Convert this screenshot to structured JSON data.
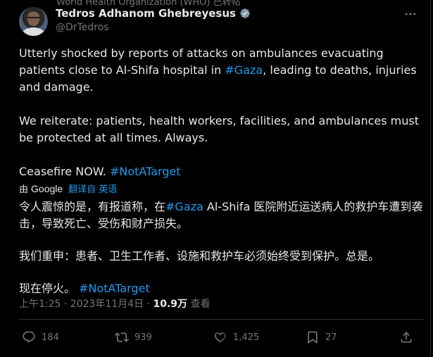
{
  "context": {
    "text": "World Health Organization (WHO) 已转帖"
  },
  "author": {
    "display_name": "Tedros Adhanom Ghebreyesus",
    "handle": "@DrTedros"
  },
  "tweet": {
    "para1": {
      "before": "Utterly shocked by reports of attacks on ambulances evacuating patients close to Al-Shifa hospital in ",
      "hashtag": "#Gaza",
      "after": ", leading to deaths, injuries and damage."
    },
    "para2": "We reiterate: patients, health workers, facilities, and ambulances must be protected at all times. Always.",
    "para3": {
      "before": "Ceasefire NOW. ",
      "hashtag": "#NotATarget"
    }
  },
  "translation": {
    "by_label": "由",
    "google_label": "Google",
    "action_label": "翻译自 英语",
    "para1": {
      "before": "令人震惊的是，有报道称，在",
      "hashtag": "#Gaza",
      "after": " Al-Shifa 医院附近运送病人的救护车遭到袭击，导致死亡、受伤和财产损失。"
    },
    "para2": "我们重申：患者、卫生工作者、设施和救护车必须始终受到保护。总是。",
    "para3": {
      "before": "现在停火。 ",
      "hashtag": "#NotATarget"
    }
  },
  "meta": {
    "time": "上午1:25 · 2023年11月4日 · ",
    "views": "10.9万",
    "views_label": " 查看"
  },
  "actions": {
    "replies": "184",
    "reposts": "939",
    "likes": "1,425",
    "bookmarks": "27"
  },
  "colors": {
    "background": "#000000",
    "text": "#e7e9ea",
    "muted": "#71767b",
    "link": "#1d9bf0",
    "divider": "#2f3336"
  }
}
